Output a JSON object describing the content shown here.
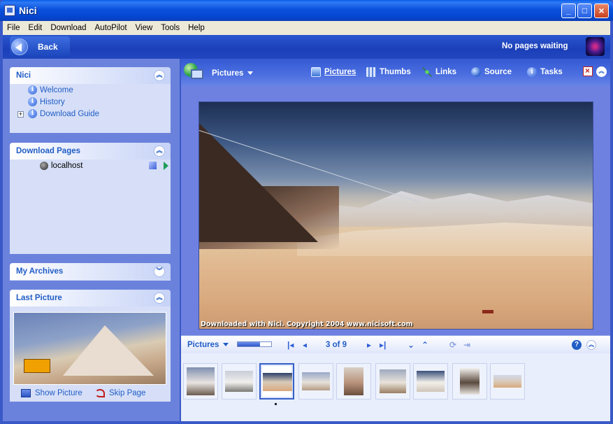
{
  "window": {
    "title": "Nici"
  },
  "menu": [
    "File",
    "Edit",
    "Download",
    "AutoPilot",
    "View",
    "Tools",
    "Help"
  ],
  "toolbar": {
    "back_label": "Back",
    "status": "No pages waiting"
  },
  "sidebar": {
    "nici": {
      "title": "Nici",
      "items": [
        "Welcome",
        "History",
        "Download Guide"
      ]
    },
    "download_pages": {
      "title": "Download Pages",
      "items": [
        "localhost"
      ]
    },
    "archives": {
      "title": "My Archives"
    },
    "last_picture": {
      "title": "Last Picture",
      "show_label": "Show Picture",
      "skip_label": "Skip Page"
    }
  },
  "viewer": {
    "title": "Pictures",
    "tabs": [
      "Pictures",
      "Thumbs",
      "Links",
      "Source",
      "Tasks"
    ],
    "active_tab": "Pictures",
    "caption": "Downloaded with Nici. Copyright 2004 www.nicisoft.com"
  },
  "navigator": {
    "title": "Pictures",
    "counter": "3 of 9",
    "progress": 0.67,
    "current": 3,
    "total": 9
  },
  "thumbnails": {
    "count": 9,
    "selected_index": 2
  },
  "colors": {
    "accent": "#215dc6",
    "titlebar": "#0a52dc",
    "panel_bg": "#d6dff7",
    "pane_bg": "#6b82dc"
  }
}
